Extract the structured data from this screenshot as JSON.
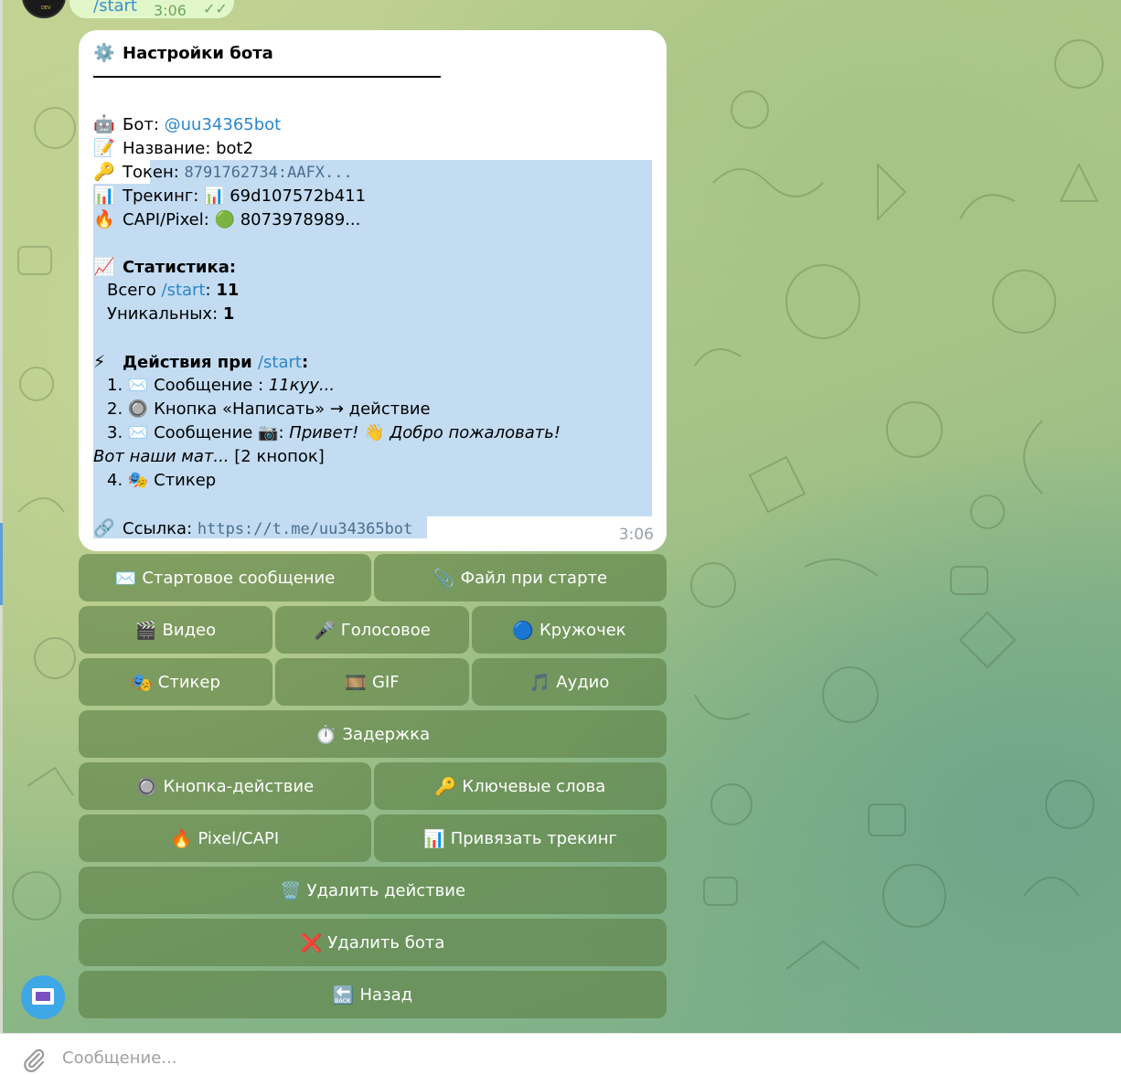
{
  "previous_message": {
    "text": "/start",
    "time": "3:06",
    "check": "✓✓",
    "avatar_label": "DEV"
  },
  "settings": {
    "title": "Настройки бота",
    "title_icon": "⚙️",
    "bot_icon": "🤖",
    "bot_label": "Бот: ",
    "bot_username": "@uu34365bot",
    "name_icon": "📝",
    "name_label": "Название: ",
    "name_value": "bot2",
    "token_icon": "🔑",
    "token_label": "Токен: ",
    "token_value": "8791762734:AAFX...",
    "tracking_icon": "📊",
    "tracking_label": "Трекинг: ",
    "tracking_value_icon": "📊",
    "tracking_value": "69d107572b411",
    "capi_icon": "🔥",
    "capi_label": "CAPI/Pixel: ",
    "capi_status_icon": "🟢",
    "capi_value": "8073978989...",
    "stats_icon": "📈",
    "stats_title": "Статистика:",
    "stats_total_label": "Всего ",
    "stats_total_cmd": "/start",
    "stats_total_sep": ": ",
    "stats_total_value": "11",
    "stats_unique_label": "Уникальных: ",
    "stats_unique_value": "1",
    "actions_icon": "⚡",
    "actions_title": "Действия при ",
    "actions_cmd": "/start",
    "actions_colon": ":",
    "actions": {
      "a1_num": "1.",
      "a1_icon": "✉️",
      "a1_text": "Сообщение : ",
      "a1_value": "11куу...",
      "a2_num": "2.",
      "a2_icon": "🔘",
      "a2_text": "Кнопка «Написать» → действие",
      "a3_num": "3.",
      "a3_icon": "✉️",
      "a3_text": "Сообщение ",
      "a3_media_icon": "📷",
      "a3_colon": ": ",
      "a3_value": "Привет! ",
      "a3_wave": "👋",
      "a3_value2": " Добро пожаловать!",
      "a3_cont": "Вот наши мат...",
      "a3_buttons": " [2 кнопок]",
      "a4_num": "4.",
      "a4_icon": "🎭",
      "a4_text": "Стикер"
    },
    "link_icon": "🔗",
    "link_label": "Ссылка: ",
    "link_value": "https://t.me/uu34365bot",
    "time": "3:06"
  },
  "keyboard": {
    "start_message": {
      "icon": "✉️",
      "label": "Стартовое сообщение"
    },
    "start_file": {
      "icon": "📎",
      "label": "Файл при старте"
    },
    "video": {
      "icon": "🎬",
      "label": "Видео"
    },
    "voice": {
      "icon": "🎤",
      "label": "Голосовое"
    },
    "circle": {
      "icon": "🔵",
      "label": "Кружочек"
    },
    "sticker": {
      "icon": "🎭",
      "label": "Стикер"
    },
    "gif": {
      "icon": "🎞️",
      "label": "GIF"
    },
    "audio": {
      "icon": "🎵",
      "label": "Аудио"
    },
    "delay": {
      "icon": "⏱️",
      "label": "Задержка"
    },
    "button_action": {
      "icon": "🔘",
      "label": "Кнопка-действие"
    },
    "keywords": {
      "icon": "🔑",
      "label": "Ключевые слова"
    },
    "pixel": {
      "icon": "🔥",
      "label": "Pixel/CAPI"
    },
    "tracking": {
      "icon": "📊",
      "label": "Привязать трекинг"
    },
    "delete_action": {
      "icon": "🗑️",
      "label": "Удалить действие"
    },
    "delete_bot": {
      "icon": "❌",
      "label": "Удалить бота"
    },
    "back": {
      "icon": "🔙",
      "label": "Назад"
    }
  },
  "composer": {
    "placeholder": "Сообщение..."
  }
}
